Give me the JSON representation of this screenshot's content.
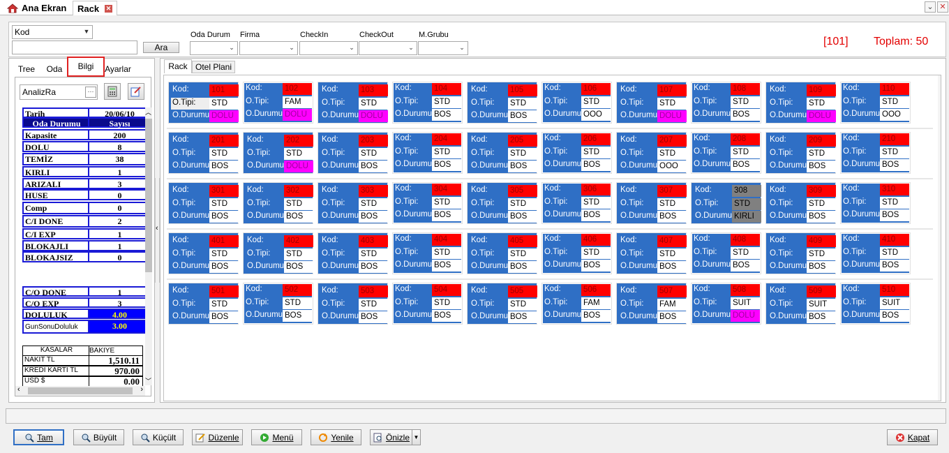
{
  "tabs": {
    "home": "Ana Ekran",
    "rack": "Rack"
  },
  "filters": {
    "kod_select": "Kod",
    "search_value": "",
    "search_button": "Ara",
    "oda_durum": "Oda Durum",
    "firma": "Firma",
    "checkin": "CheckIn",
    "checkout": "CheckOut",
    "mgrubu": "M.Grubu",
    "selected_room": "[101]",
    "toplam": "Toplam: 50"
  },
  "left": {
    "tabs": [
      "Tree",
      "Oda",
      "Bilgi",
      "Ayarlar"
    ],
    "analiz_value": "AnalizRa",
    "header": {
      "k": "Tarih",
      "v": "20/06/10"
    },
    "columns": {
      "k": "Oda Durumu",
      "v": "Sayısı"
    },
    "stats": [
      {
        "k": "Kapasite",
        "v": "200"
      },
      {
        "k": "DOLU",
        "v": "8"
      },
      {
        "k": "TEMİZ",
        "v": "38"
      },
      {
        "k": "KIRLI",
        "v": "1"
      },
      {
        "k": "ARIZALI",
        "v": "3"
      },
      {
        "k": "HUSE",
        "v": "0"
      },
      {
        "k": "Comp",
        "v": "0"
      },
      {
        "k": "C/I DONE",
        "v": "2"
      },
      {
        "k": "C/I EXP",
        "v": "1"
      },
      {
        "k": "BLOKAJLI",
        "v": "1"
      },
      {
        "k": "BLOKAJSIZ",
        "v": "0"
      }
    ],
    "co": [
      {
        "k": "C/O DONE",
        "v": "1"
      },
      {
        "k": "C/O EXP",
        "v": "3"
      },
      {
        "k": "DOLULUK",
        "v": "4.00"
      },
      {
        "k": "GunSonuDoluluk",
        "v": "3.00"
      }
    ],
    "kasa_header": {
      "k": "KASALAR",
      "v": "BAKIYE"
    },
    "kasa": [
      {
        "k": "NAKIT TL",
        "v": "1,510.11"
      },
      {
        "k": "KREDI KARTI TL",
        "v": "970.00"
      },
      {
        "k": "USD $",
        "v": "0.00"
      }
    ]
  },
  "main": {
    "tabs": [
      "Rack",
      "Otel Plani"
    ],
    "labels": {
      "kod": "Kod:",
      "tipi": "O.Tipi:",
      "durum": "O.Durumu:"
    },
    "rooms": [
      [
        {
          "c": "101",
          "t": "STD",
          "d": "DOLU",
          "s": "sel"
        },
        {
          "c": "102",
          "t": "FAM",
          "d": "DOLU",
          "s": "light"
        },
        {
          "c": "103",
          "t": "STD",
          "d": "DOLU"
        },
        {
          "c": "104",
          "t": "STD",
          "d": "BOS",
          "s": "light"
        },
        {
          "c": "105",
          "t": "STD",
          "d": "BOS"
        },
        {
          "c": "106",
          "t": "STD",
          "d": "OOO",
          "s": "light"
        },
        {
          "c": "107",
          "t": "STD",
          "d": "DOLU"
        },
        {
          "c": "108",
          "t": "STD",
          "d": "BOS",
          "s": "light"
        },
        {
          "c": "109",
          "t": "STD",
          "d": "DOLU"
        },
        {
          "c": "110",
          "t": "STD",
          "d": "OOO",
          "s": "light"
        }
      ],
      [
        {
          "c": "201",
          "t": "STD",
          "d": "BOS"
        },
        {
          "c": "202",
          "t": "STD",
          "d": "DOLU"
        },
        {
          "c": "203",
          "t": "STD",
          "d": "BOS"
        },
        {
          "c": "204",
          "t": "STD",
          "d": "BOS",
          "s": "light"
        },
        {
          "c": "205",
          "t": "STD",
          "d": "BOS"
        },
        {
          "c": "206",
          "t": "STD",
          "d": "BOS",
          "s": "light"
        },
        {
          "c": "207",
          "t": "STD",
          "d": "OOO"
        },
        {
          "c": "208",
          "t": "STD",
          "d": "BOS",
          "s": "light"
        },
        {
          "c": "209",
          "t": "STD",
          "d": "BOS"
        },
        {
          "c": "210",
          "t": "STD",
          "d": "BOS",
          "s": "light"
        }
      ],
      [
        {
          "c": "301",
          "t": "STD",
          "d": "BOS"
        },
        {
          "c": "302",
          "t": "STD",
          "d": "BOS"
        },
        {
          "c": "303",
          "t": "STD",
          "d": "BOS"
        },
        {
          "c": "304",
          "t": "STD",
          "d": "BOS",
          "s": "light"
        },
        {
          "c": "305",
          "t": "STD",
          "d": "BOS"
        },
        {
          "c": "306",
          "t": "STD",
          "d": "BOS",
          "s": "light"
        },
        {
          "c": "307",
          "t": "STD",
          "d": "BOS"
        },
        {
          "c": "308",
          "t": "STD",
          "d": "KIRLI",
          "s": "dirty"
        },
        {
          "c": "309",
          "t": "STD",
          "d": "BOS"
        },
        {
          "c": "310",
          "t": "STD",
          "d": "BOS",
          "s": "light"
        }
      ],
      [
        {
          "c": "401",
          "t": "STD",
          "d": "BOS"
        },
        {
          "c": "402",
          "t": "STD",
          "d": "BOS"
        },
        {
          "c": "403",
          "t": "STD",
          "d": "BOS"
        },
        {
          "c": "404",
          "t": "STD",
          "d": "BOS",
          "s": "light"
        },
        {
          "c": "405",
          "t": "STD",
          "d": "BOS"
        },
        {
          "c": "406",
          "t": "STD",
          "d": "BOS",
          "s": "light"
        },
        {
          "c": "407",
          "t": "STD",
          "d": "BOS"
        },
        {
          "c": "408",
          "t": "STD",
          "d": "BOS",
          "s": "light"
        },
        {
          "c": "409",
          "t": "STD",
          "d": "BOS"
        },
        {
          "c": "410",
          "t": "STD",
          "d": "BOS",
          "s": "light"
        }
      ],
      [
        {
          "c": "501",
          "t": "STD",
          "d": "BOS"
        },
        {
          "c": "502",
          "t": "STD",
          "d": "BOS",
          "s": "light"
        },
        {
          "c": "503",
          "t": "STD",
          "d": "BOS"
        },
        {
          "c": "504",
          "t": "STD",
          "d": "BOS",
          "s": "light"
        },
        {
          "c": "505",
          "t": "STD",
          "d": "BOS"
        },
        {
          "c": "506",
          "t": "FAM",
          "d": "BOS",
          "s": "light"
        },
        {
          "c": "507",
          "t": "FAM",
          "d": "BOS"
        },
        {
          "c": "508",
          "t": "SUIT",
          "d": "DOLU",
          "s": "light"
        },
        {
          "c": "509",
          "t": "SUIT",
          "d": "BOS"
        },
        {
          "c": "510",
          "t": "SUIT",
          "d": "BOS",
          "s": "light"
        }
      ]
    ]
  },
  "bottom": {
    "buttons": [
      "Tam",
      "Büyült",
      "Küçült",
      "Düzenle",
      "Menü",
      "Yenile",
      "Önizle"
    ],
    "kapat": "Kapat"
  },
  "colors": {
    "blue": "#2f6fc5",
    "red": "#ff0000",
    "magenta": "#ff00ff",
    "gray": "#808080"
  }
}
